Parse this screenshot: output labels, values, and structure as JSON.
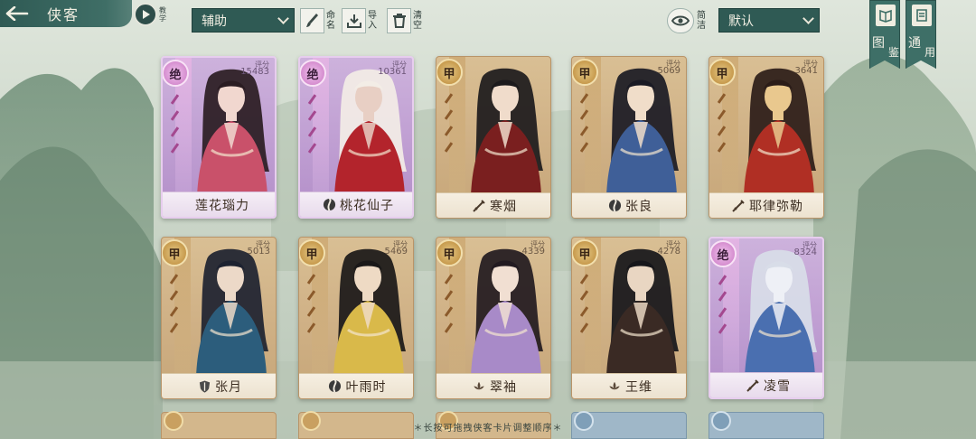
{
  "header": {
    "back_title": "侠客",
    "tutorial_label": "教学",
    "filter_value": "辅助",
    "name_label": "命名",
    "import_label": "导入",
    "clear_label": "清空",
    "simple_label": "简洁",
    "sort_value": "默认",
    "codex_label_1": "图",
    "codex_label_2": "鉴",
    "general_label_1": "通",
    "general_label_2": "用"
  },
  "score_label": "评分",
  "cards": [
    {
      "name": "莲花瑙力",
      "rank": "绝",
      "score": "15483",
      "tier": "jue",
      "faction": "none",
      "palette": [
        "#2a1c22",
        "#c9516a",
        "#f1d7cf"
      ]
    },
    {
      "name": "桃花仙子",
      "rank": "绝",
      "score": "10361",
      "tier": "jue",
      "faction": "swirl",
      "palette": [
        "#f3ede6",
        "#b3242c",
        "#e8cfc4"
      ]
    },
    {
      "name": "寒烟",
      "rank": "甲",
      "score": "",
      "tier": "jia",
      "faction": "sword",
      "palette": [
        "#1c1a1c",
        "#7a1f1f",
        "#f0dccb"
      ]
    },
    {
      "name": "张良",
      "rank": "甲",
      "score": "5069",
      "tier": "jia",
      "faction": "swirl",
      "palette": [
        "#1a1a24",
        "#3f5f98",
        "#f0ddc9"
      ]
    },
    {
      "name": "耶律弥勒",
      "rank": "甲",
      "score": "3641",
      "tier": "jia",
      "faction": "sword",
      "palette": [
        "#2b1c18",
        "#b02f24",
        "#e9c88e"
      ]
    },
    {
      "name": "张月",
      "rank": "甲",
      "score": "5013",
      "tier": "jia",
      "faction": "shield",
      "palette": [
        "#1d2230",
        "#2c5d7c",
        "#ecd9c8"
      ]
    },
    {
      "name": "叶雨时",
      "rank": "甲",
      "score": "5469",
      "tier": "jia",
      "faction": "swirl",
      "palette": [
        "#1a1818",
        "#d9b94a",
        "#eedac4"
      ]
    },
    {
      "name": "翠袖",
      "rank": "甲",
      "score": "4339",
      "tier": "jia",
      "faction": "lotus",
      "palette": [
        "#221a20",
        "#a88ac8",
        "#f1dfd2"
      ]
    },
    {
      "name": "王维",
      "rank": "甲",
      "score": "4278",
      "tier": "jia",
      "faction": "lotus",
      "palette": [
        "#16161a",
        "#3a2a24",
        "#e9d6c2"
      ]
    },
    {
      "name": "凌雪",
      "rank": "绝",
      "score": "8324",
      "tier": "jue",
      "faction": "sword",
      "palette": [
        "#d8dde8",
        "#4a6fb0",
        "#eef0f6"
      ]
    }
  ],
  "hint_text": "＊长按可拖拽侠客卡片调整顺序＊",
  "colors": {
    "accent": "#2f5a54",
    "jia_card": "#cfb085",
    "jue_card": "#bf9ed2"
  }
}
